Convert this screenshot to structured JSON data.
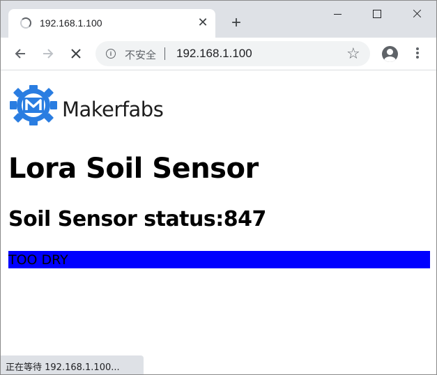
{
  "browser": {
    "tab": {
      "title": "192.168.1.100",
      "loading": true
    },
    "toolbar": {
      "security_label": "不安全",
      "url": "192.168.1.100"
    },
    "status_bubble": "正在等待 192.168.1.100..."
  },
  "icons": {
    "tab_spinner": "loading-spinner-icon",
    "tab_close": "close-icon",
    "new_tab": "plus-icon",
    "back": "arrow-left-icon",
    "forward": "arrow-right-icon",
    "stop": "stop-icon",
    "info": "info-icon",
    "star": "star-icon",
    "profile": "profile-icon",
    "menu": "kebab-menu-icon"
  },
  "page": {
    "logo_text": "Makerfabs",
    "title": "Lora Soil Sensor",
    "status_heading": "Soil Sensor status:847",
    "status_label": "TOO DRY"
  },
  "colors": {
    "logo_blue": "#2a7de1",
    "status_bar": "#0000ff",
    "chrome_frame": "#dee1e6"
  }
}
